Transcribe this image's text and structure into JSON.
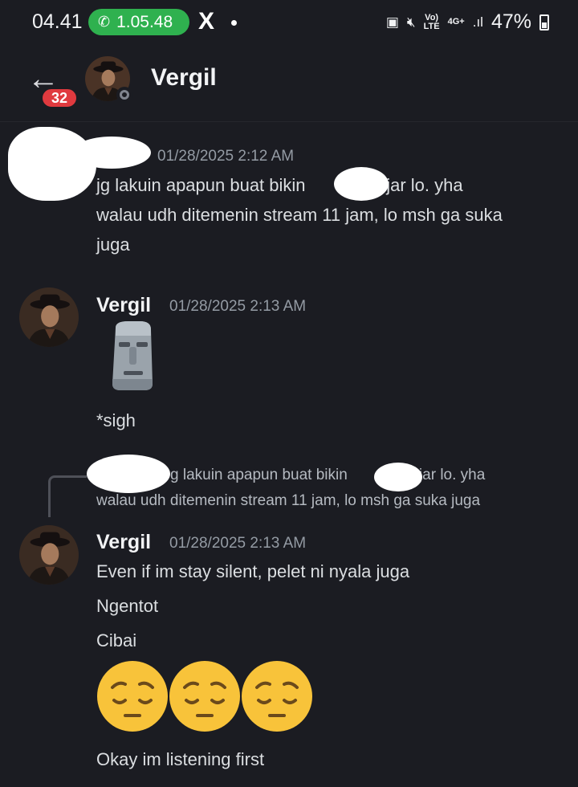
{
  "status_bar": {
    "time": "04.41",
    "call_duration": "1.05.48",
    "x_logo": "X",
    "network": "4G+",
    "volte": "Vo))\nLTE",
    "battery": "47%"
  },
  "header": {
    "unread_count": "32",
    "contact_name": "Vergil"
  },
  "messages": [
    {
      "timestamp": "01/28/2025 2:12 AM",
      "lines": [
        "jg lakuin apapun buat bikin",
        "ngejar lo. yha",
        "walau udh ditemenin stream 11 jam, lo msh ga suka",
        "juga"
      ]
    },
    {
      "author": "Vergil",
      "timestamp": "01/28/2025 2:13 AM",
      "emoji": "moai",
      "text": "*sigh"
    },
    {
      "reply_preview": [
        "g lakuin apapun buat bikin",
        "gejar lo. yha",
        "walau udh ditemenin stream 11 jam, lo msh ga suka juga"
      ],
      "author": "Vergil",
      "timestamp": "01/28/2025 2:13 AM",
      "lines": [
        "Even if im stay silent, pelet ni nyala juga",
        "Ngentot",
        "Cibai"
      ],
      "emojis": [
        "pensive-face",
        "pensive-face",
        "pensive-face"
      ],
      "last_line": "Okay im listening first"
    }
  ],
  "colors": {
    "background": "#1b1c22",
    "call_pill": "#2fb14f",
    "badge": "#e03a3f"
  }
}
